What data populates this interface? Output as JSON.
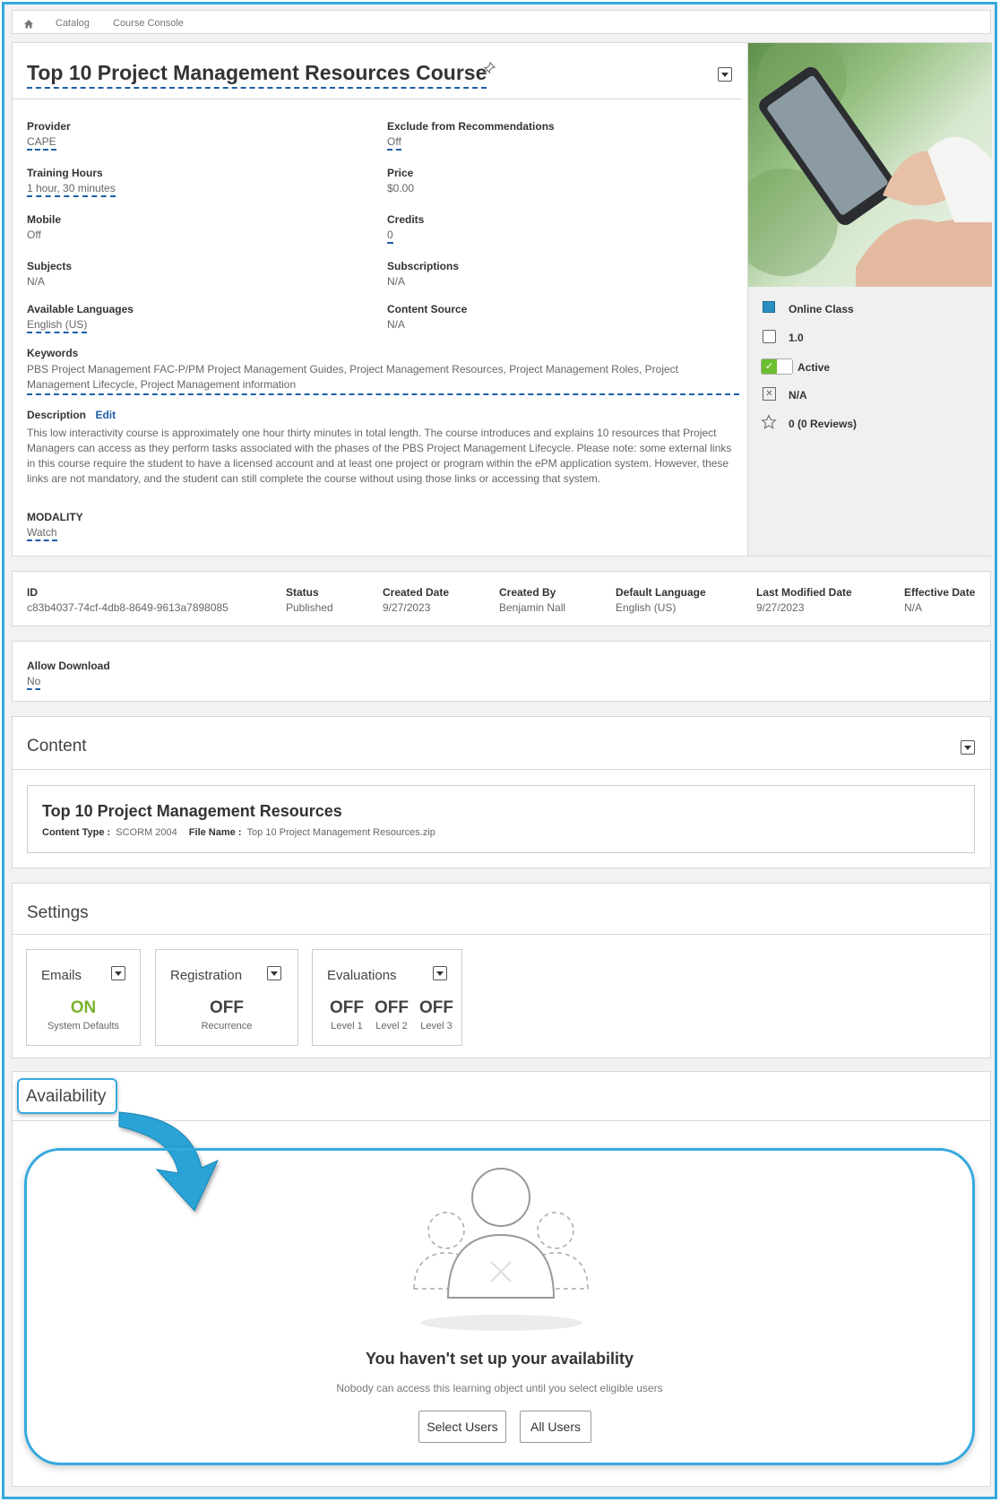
{
  "breadcrumb": {
    "items": [
      "Catalog",
      "Course Console"
    ]
  },
  "course": {
    "title": "Top 10 Project Management Resources Course",
    "fields_left": [
      {
        "label": "Provider",
        "value": "CAPE",
        "link": true
      },
      {
        "label": "Training Hours",
        "value": "1 hour, 30 minutes",
        "link": true
      },
      {
        "label": "Mobile",
        "value": "Off",
        "link": false
      },
      {
        "label": "Subjects",
        "value": "N/A",
        "link": false
      },
      {
        "label": "Available Languages",
        "value": "English (US)",
        "link": true
      }
    ],
    "fields_right": [
      {
        "label": "Exclude from Recommendations",
        "value": "Off",
        "link": true
      },
      {
        "label": "Price",
        "value": "$0.00",
        "link": false
      },
      {
        "label": "Credits",
        "value": "0",
        "link": true
      },
      {
        "label": "Subscriptions",
        "value": "N/A",
        "link": false
      },
      {
        "label": "Content Source",
        "value": "N/A",
        "link": false
      }
    ],
    "keywords_label": "Keywords",
    "keywords": "PBS Project Management FAC-P/PM Project Management Guides, Project Management Resources, Project Management Roles, Project Management Lifecycle, Project Management information",
    "description_label": "Description",
    "description_edit": "Edit",
    "description": "This low interactivity course is approximately one hour thirty minutes in total length. The course introduces and explains 10 resources that Project Managers can access as they perform tasks associated with the phases of the PBS Project Management Lifecycle. Please note: some external links in this course require the student to have a licensed account and at least one project or program within the ePM application system. However, these links are not mandatory, and the student can still complete the course without using those links or accessing that system.",
    "modality_label": "MODALITY",
    "modality_value": "Watch"
  },
  "side": {
    "type": "Online Class",
    "version": "1.0",
    "status": "Active",
    "na": "N/A",
    "rating": "0 (0 Reviews)",
    "colors": {
      "type_square": "#2a8fc0",
      "toggle_on": "#6abf2e"
    }
  },
  "meta": [
    {
      "label": "ID",
      "value": "c83b4037-74cf-4db8-8649-9613a7898085"
    },
    {
      "label": "Status",
      "value": "Published"
    },
    {
      "label": "Created Date",
      "value": "9/27/2023"
    },
    {
      "label": "Created By",
      "value": "Benjamin Nall"
    },
    {
      "label": "Default Language",
      "value": "English (US)"
    },
    {
      "label": "Last Modified Date",
      "value": "9/27/2023"
    },
    {
      "label": "Effective Date",
      "value": "N/A"
    }
  ],
  "download": {
    "label": "Allow Download",
    "value": "No"
  },
  "content": {
    "section_title": "Content",
    "item_title": "Top 10 Project Management Resources",
    "type_label": "Content Type :",
    "type_value": "SCORM 2004",
    "file_label": "File Name :",
    "file_value": "Top 10 Project Management Resources.zip"
  },
  "settings": {
    "section_title": "Settings",
    "emails": {
      "name": "Emails",
      "value": "ON",
      "sub": "System Defaults"
    },
    "registration": {
      "name": "Registration",
      "value": "OFF",
      "sub": "Recurrence"
    },
    "evaluations": {
      "name": "Evaluations",
      "levels": [
        {
          "value": "OFF",
          "sub": "Level 1"
        },
        {
          "value": "OFF",
          "sub": "Level 2"
        },
        {
          "value": "OFF",
          "sub": "Level 3"
        }
      ]
    }
  },
  "availability": {
    "section_title": "Availability",
    "heading": "You haven't set up your availability",
    "message": "Nobody can access this learning object until you select eligible users",
    "select_users": "Select Users",
    "all_users": "All Users",
    "highlight_color": "#36a9df"
  }
}
